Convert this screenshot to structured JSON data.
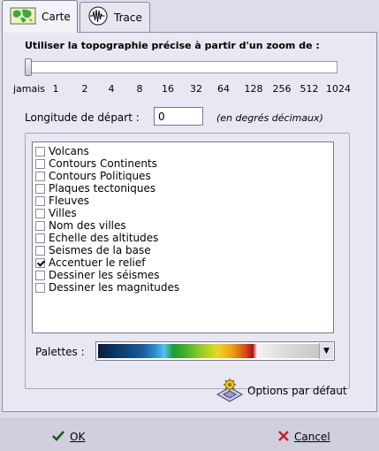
{
  "tabs": [
    {
      "label": "Carte",
      "icon": "world-map-icon",
      "active": true
    },
    {
      "label": "Trace",
      "icon": "seismograph-icon",
      "active": false
    }
  ],
  "topography": {
    "label": "Utiliser la topographie précise à partir d'un zoom de :",
    "slider_value": "jamais",
    "ticks": [
      "jamais",
      "1",
      "2",
      "4",
      "8",
      "16",
      "32",
      "64",
      "128",
      "256",
      "512",
      "1024"
    ]
  },
  "longitude": {
    "label": "Longitude de départ :",
    "value": "0",
    "hint": "(en degrés décimaux)"
  },
  "layers": [
    {
      "label": "Volcans",
      "checked": false
    },
    {
      "label": "Contours Continents",
      "checked": false
    },
    {
      "label": "Contours Politiques",
      "checked": false
    },
    {
      "label": "Plaques tectoniques",
      "checked": false
    },
    {
      "label": "Fleuves",
      "checked": false
    },
    {
      "label": "Villes",
      "checked": false
    },
    {
      "label": "Nom des villes",
      "checked": false
    },
    {
      "label": "Echelle des altitudes",
      "checked": false
    },
    {
      "label": "Seismes de la base",
      "checked": false
    },
    {
      "label": "Accentuer le relief",
      "checked": true
    },
    {
      "label": "Dessiner les séismes",
      "checked": false
    },
    {
      "label": "Dessiner les magnitudes",
      "checked": false
    }
  ],
  "palette": {
    "label": "Palettes :",
    "selected": "rainbow-elevation"
  },
  "defaults_button": {
    "label": "Options par défaut",
    "icon": "defaults-gear-icon"
  },
  "buttons": {
    "ok": "OK",
    "cancel": "Cancel"
  },
  "colors": {
    "background": "#dcdcea",
    "check": "#000000",
    "ok_icon": "#1a5a1a",
    "cancel_icon": "#cc2020"
  }
}
